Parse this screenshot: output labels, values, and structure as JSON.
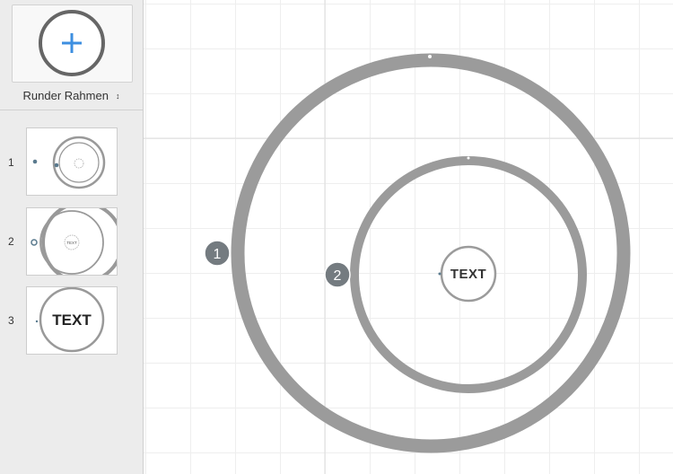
{
  "sidebar": {
    "add_icon": "plus-circle-icon",
    "frame_select": {
      "label": "Runder Rahmen",
      "icon": "sort-arrows-icon"
    },
    "layers": [
      {
        "number": "1",
        "thumb_label": ""
      },
      {
        "number": "2",
        "thumb_label": "TEXT"
      },
      {
        "number": "3",
        "thumb_label": "TEXT"
      }
    ]
  },
  "canvas": {
    "markers": [
      {
        "label": "1"
      },
      {
        "label": "2"
      }
    ],
    "center_text": "TEXT"
  },
  "colors": {
    "accent": "#3d8fe0",
    "frame": "#9b9b9b",
    "marker": "#747b80",
    "grid": "#eeeeee"
  }
}
